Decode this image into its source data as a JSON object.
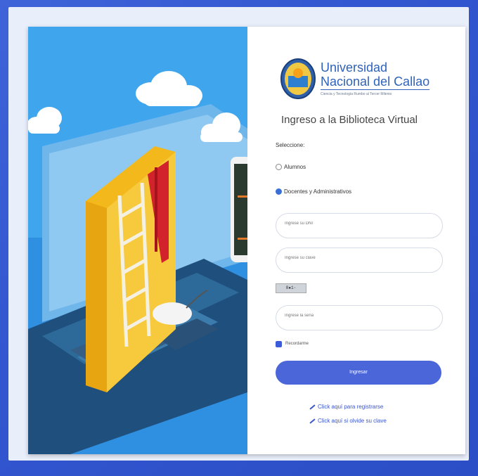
{
  "login": {
    "university_line1": "Universidad",
    "university_line2": "Nacional del Callao",
    "university_tagline": "Ciencia y Tecnología Rumbo al Tercer Milenio",
    "subtitle": "Ingreso a la Biblioteca Virtual",
    "select_label": "Seleccione:",
    "radio_students": "Alumnos",
    "radio_staff": "Docentes y Administrativos",
    "dni_placeholder": "Ingrese su DNI",
    "password_placeholder": "Ingrese su clave",
    "captcha_text": "8●1◦",
    "captcha_placeholder": "Ingrese la seña",
    "remember_label": "Recordarme",
    "submit_label": "Ingresar",
    "link_register": "Click aquí para registrarse",
    "link_forgot": "Click aquí si olvide su clave"
  },
  "colors": {
    "accent": "#4a66d9",
    "brand": "#2f62b8",
    "background": "#3256cf"
  }
}
